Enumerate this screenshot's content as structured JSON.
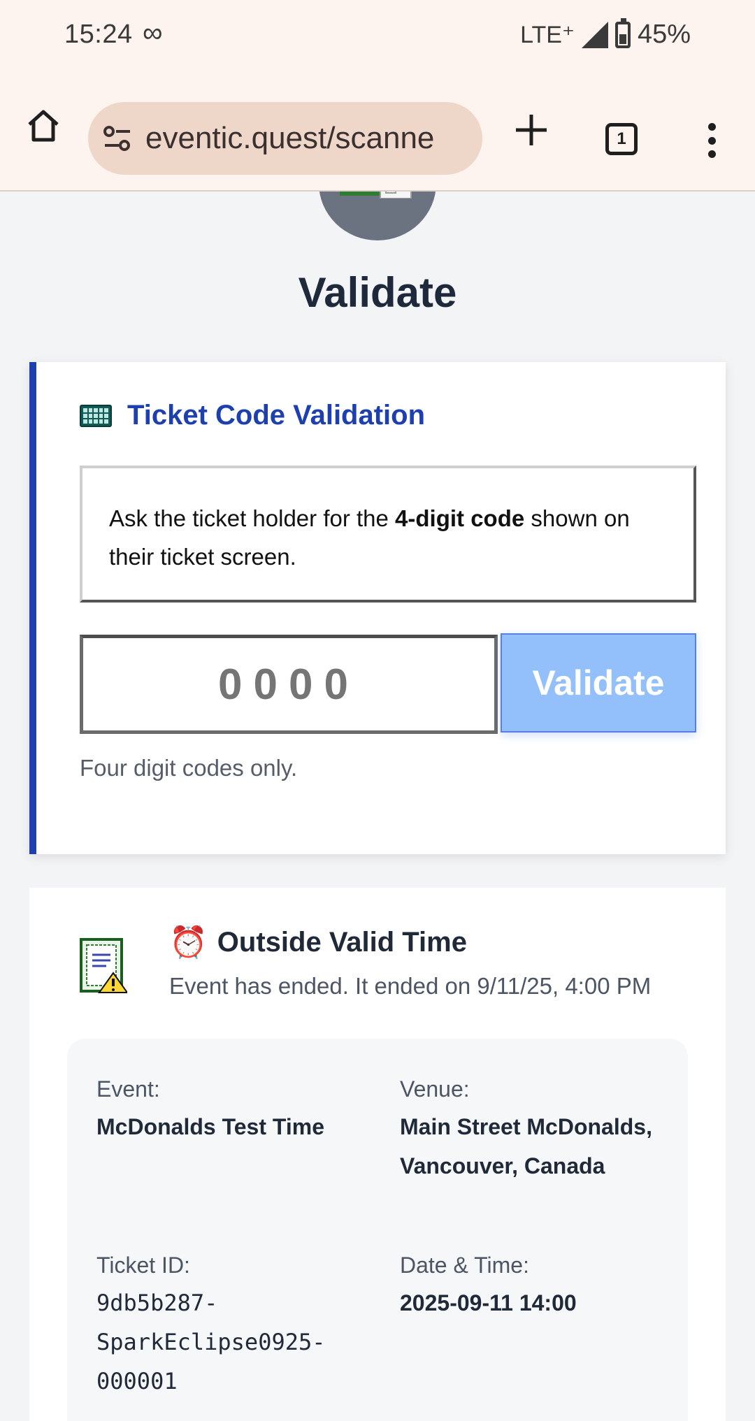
{
  "status_bar": {
    "time": "15:24",
    "infinity_symbol": "∞",
    "network": "LTE⁺",
    "battery": "45%"
  },
  "browser": {
    "url": "eventic.quest/scanne",
    "tab_count": "1",
    "icons": [
      "home-icon",
      "site-settings-icon",
      "new-tab-icon",
      "tabs-icon",
      "more-menu-icon"
    ]
  },
  "page": {
    "title": "Validate"
  },
  "validation_card": {
    "title": "Ticket Code Validation",
    "info_prefix": "Ask the ticket holder for the ",
    "info_bold": "4-digit code",
    "info_suffix": " shown on their ticket screen.",
    "code_placeholder": "0000",
    "button_label": "Validate",
    "hint": "Four digit codes only."
  },
  "result_card": {
    "status_emoji": "⏰",
    "status_title": "Outside Valid Time",
    "status_desc": "Event has ended. It ended on 9/11/25, 4:00 PM",
    "event_label": "Event:",
    "event_value": "McDonalds Test Time",
    "venue_label": "Venue:",
    "venue_value": "Main Street McDonalds, Vancouver, Canada",
    "ticket_label": "Ticket ID:",
    "ticket_value_1": "9db5b287-",
    "ticket_value_2": "SparkEclipse0925-",
    "ticket_value_3": "000001",
    "date_label": "Date & Time:",
    "date_value": "2025-09-11 14:00"
  },
  "colors": {
    "accent": "#1e40af",
    "button_disabled": "#93c0fb",
    "browser_bg": "#fdf3ef",
    "url_bg": "#eed7c9"
  }
}
